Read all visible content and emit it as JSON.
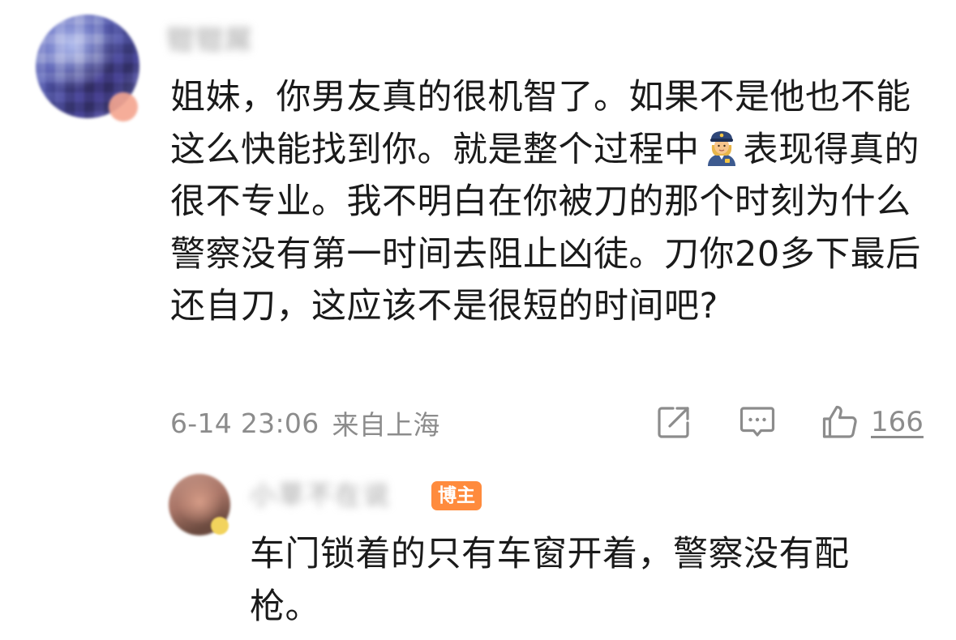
{
  "comment": {
    "username": "钳钳屌",
    "text_before_emoji": "姐妹，你男友真的很机智了。如果不是他也不能这么快能找到你。就是整个过程中",
    "emoji": "police-officer-emoji",
    "text_after_emoji": "表现得真的很不专业。我不明白在你被刀的那个时刻为什么警察没有第一时间去阻止凶徒。刀你20多下最后还自刀，这应该不是很短的时间吧?",
    "time": "6-14 23:06",
    "location": "来自上海",
    "like_count": "166",
    "icons": {
      "share": "share-icon",
      "reply": "comment-icon",
      "like": "thumbs-up-icon"
    }
  },
  "reply": {
    "username": "小草不在说",
    "author_badge": "博主",
    "text": "车门锁着的只有车窗开着，警察没有配枪。"
  },
  "colors": {
    "text_primary": "#1a1a1a",
    "text_secondary": "#8c8c8c",
    "author_badge_bg": "#ff8b3d"
  }
}
